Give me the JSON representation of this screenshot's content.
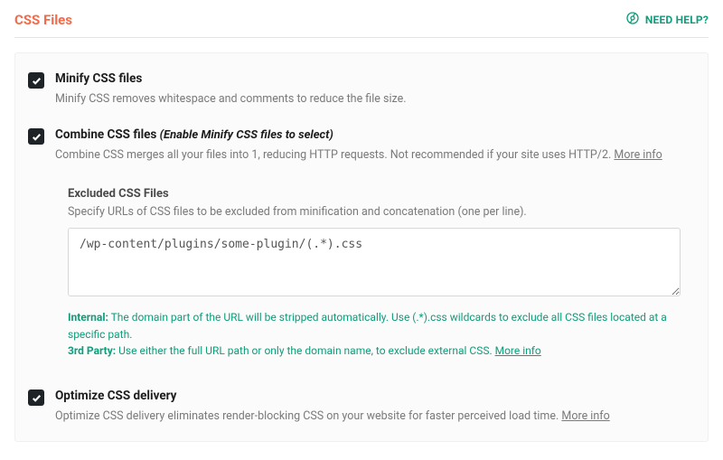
{
  "header": {
    "title": "CSS Files",
    "help_label": "NEED HELP?"
  },
  "settings": {
    "minify": {
      "title": "Minify CSS files",
      "desc": "Minify CSS removes whitespace and comments to reduce the file size."
    },
    "combine": {
      "title": "Combine CSS files",
      "note": "(Enable Minify CSS files to select)",
      "desc": "Combine CSS merges all your files into 1, reducing HTTP requests. Not recommended if your site uses HTTP/2.",
      "more_info": "More info"
    },
    "excluded": {
      "title": "Excluded CSS Files",
      "desc": "Specify URLs of CSS files to be excluded from minification and concatenation (one per line).",
      "value": "/wp-content/plugins/some-plugin/(.*).css",
      "hint_internal_label": "Internal:",
      "hint_internal_text": " The domain part of the URL will be stripped automatically. Use (.*).css wildcards to exclude all CSS files located at a specific path.",
      "hint_thirdparty_label": "3rd Party:",
      "hint_thirdparty_text": " Use either the full URL path or only the domain name, to exclude external CSS. ",
      "more_info": "More info"
    },
    "optimize": {
      "title": "Optimize CSS delivery",
      "desc": "Optimize CSS delivery eliminates render-blocking CSS on your website for faster perceived load time.",
      "more_info": "More info"
    }
  }
}
